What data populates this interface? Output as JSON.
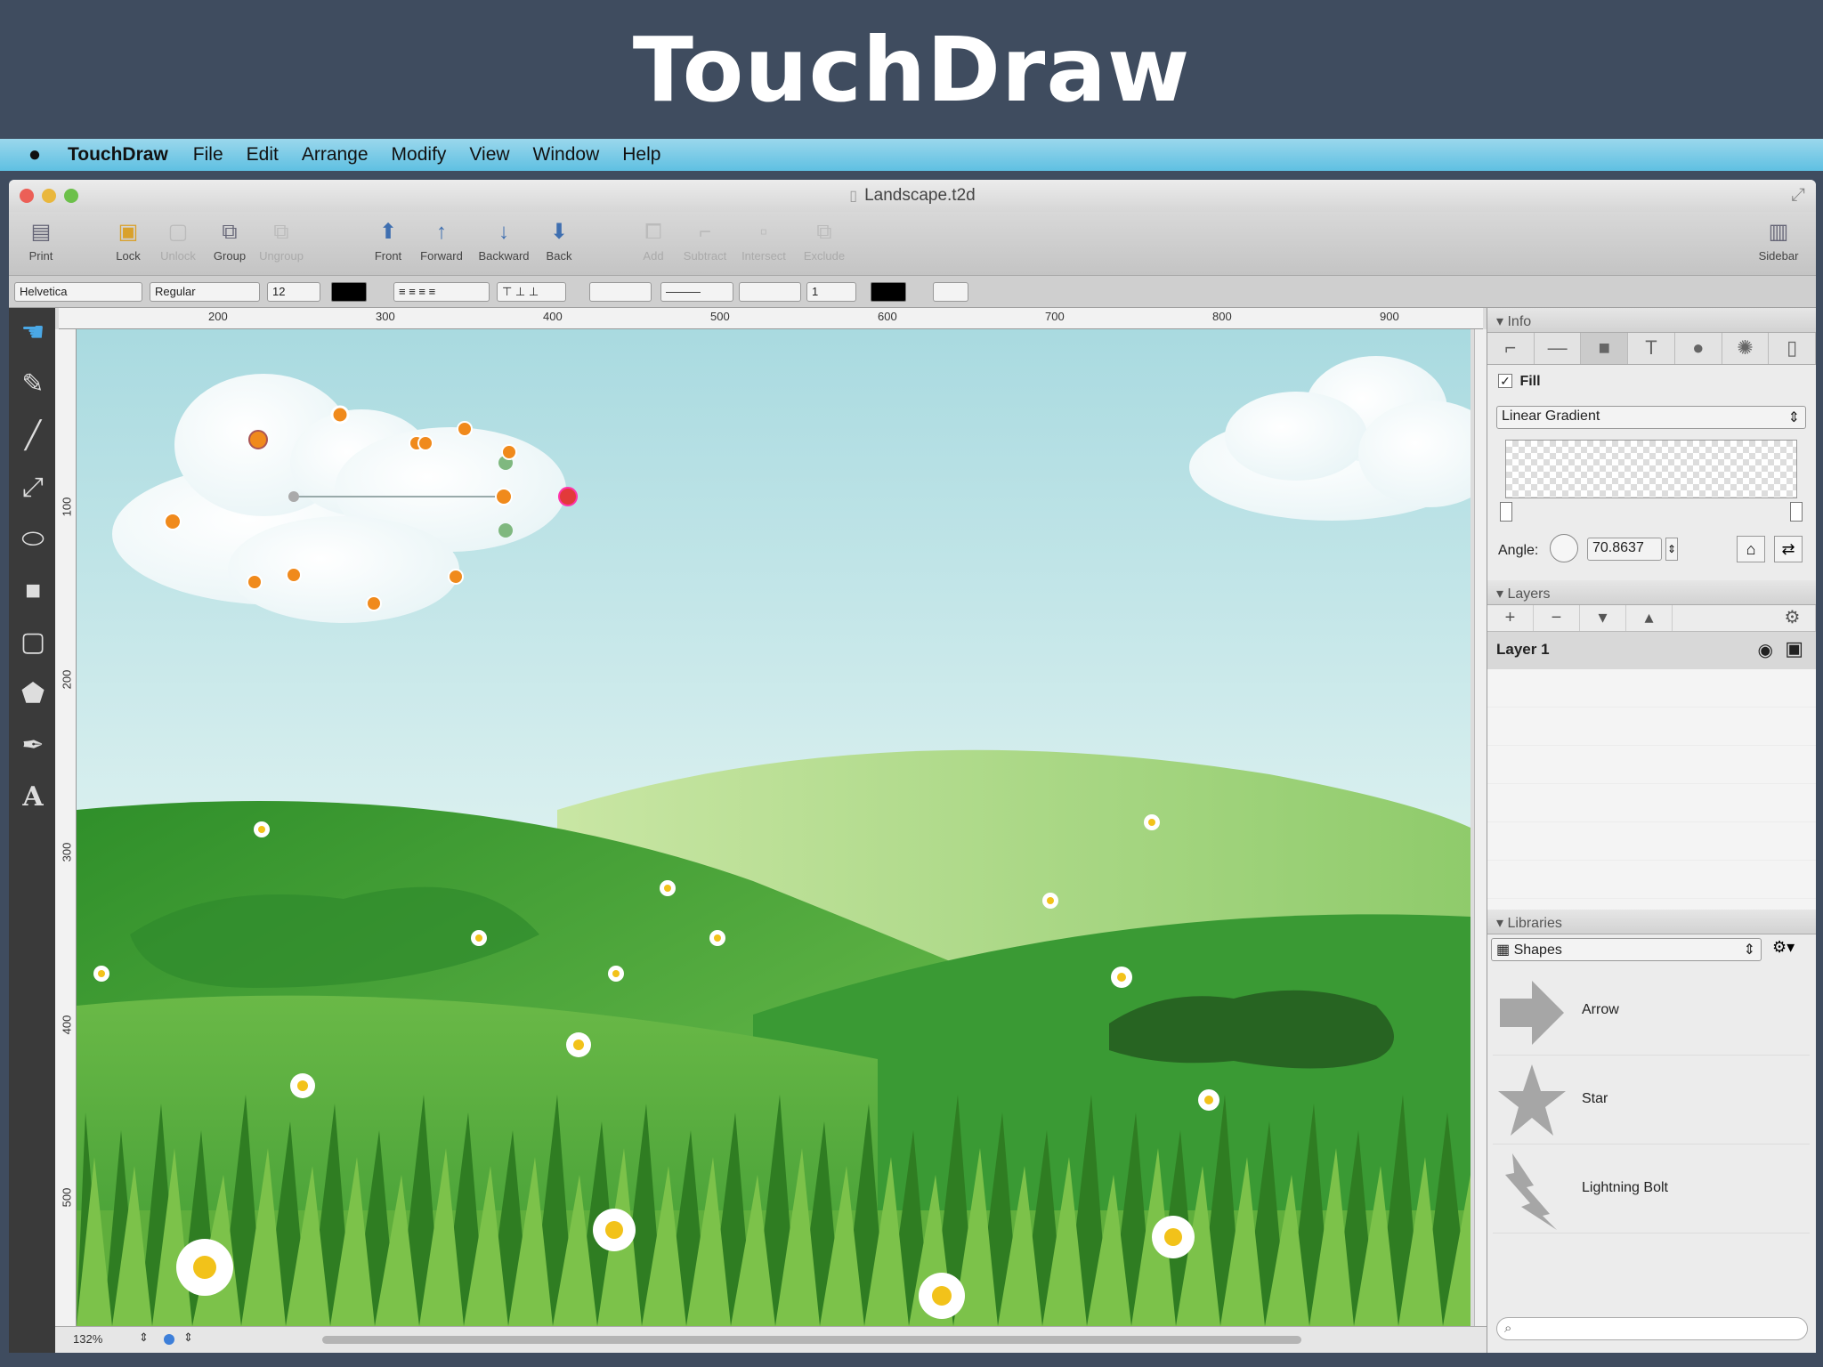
{
  "banner": {
    "title": "TouchDraw"
  },
  "menubar": {
    "app": "TouchDraw",
    "items": [
      "File",
      "Edit",
      "Arrange",
      "Modify",
      "View",
      "Window",
      "Help"
    ]
  },
  "window": {
    "title": "Landscape.t2d"
  },
  "toolbar": {
    "print": "Print",
    "lock": "Lock",
    "unlock": "Unlock",
    "group": "Group",
    "ungroup": "Ungroup",
    "front": "Front",
    "forward": "Forward",
    "backward": "Backward",
    "back": "Back",
    "add": "Add",
    "subtract": "Subtract",
    "intersect": "Intersect",
    "exclude": "Exclude",
    "sidebar": "Sidebar"
  },
  "formatbar": {
    "font": "Helvetica",
    "style": "Regular",
    "size": "12",
    "stroke_width": "1",
    "text_color": "#000000",
    "stroke_color": "#000000"
  },
  "ruler": {
    "top": [
      "200",
      "300",
      "400",
      "500",
      "600",
      "700",
      "800",
      "900"
    ],
    "left": [
      "100",
      "200",
      "300",
      "400",
      "500"
    ]
  },
  "status": {
    "zoom": "132%"
  },
  "info": {
    "header": "Info",
    "fill_label": "Fill",
    "fill_checked": true,
    "fill_type": "Linear Gradient",
    "angle_label": "Angle:",
    "angle_value": "70.8637"
  },
  "layers": {
    "header": "Layers",
    "items": [
      "Layer 1"
    ]
  },
  "libraries": {
    "header": "Libraries",
    "selected": "Shapes",
    "items": [
      "Arrow",
      "Star",
      "Lightning Bolt"
    ]
  },
  "colors": {
    "sky_top": "#a9dae0",
    "sky_bottom": "#e3f4f2",
    "grass_dark": "#2f8f2a",
    "grass_light": "#7cc24a",
    "handle_orange": "#f08a1c",
    "handle_red": "#e23a3a",
    "handle_green": "#7fb87f"
  }
}
